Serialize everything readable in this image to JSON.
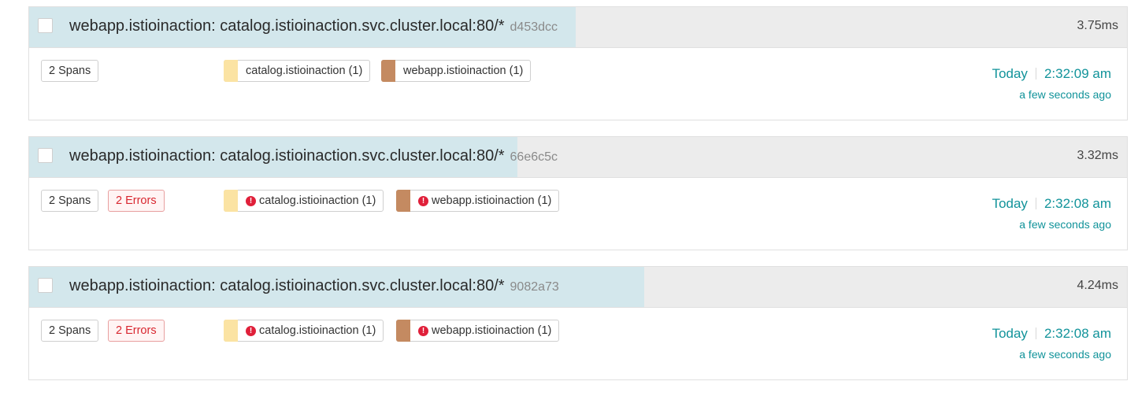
{
  "traces": [
    {
      "title": "webapp.istioinaction: catalog.istioinaction.svc.cluster.local:80/*",
      "trace_id": "d453dcc",
      "duration": "3.75ms",
      "duration_fraction": 0.498,
      "spans_label": "2 Spans",
      "errors_label": "",
      "services": [
        {
          "label": "catalog.istioinaction (1)",
          "color": "#fbe3a3",
          "error": false
        },
        {
          "label": "webapp.istioinaction (1)",
          "color": "#c48a61",
          "error": false
        }
      ],
      "date": "Today",
      "time": "2:32:09 am",
      "relative": "a few seconds ago"
    },
    {
      "title": "webapp.istioinaction: catalog.istioinaction.svc.cluster.local:80/*",
      "trace_id": "66e6c5c",
      "duration": "3.32ms",
      "duration_fraction": 0.445,
      "spans_label": "2 Spans",
      "errors_label": "2 Errors",
      "services": [
        {
          "label": "catalog.istioinaction (1)",
          "color": "#fbe3a3",
          "error": true
        },
        {
          "label": "webapp.istioinaction (1)",
          "color": "#c48a61",
          "error": true
        }
      ],
      "date": "Today",
      "time": "2:32:08 am",
      "relative": "a few seconds ago"
    },
    {
      "title": "webapp.istioinaction: catalog.istioinaction.svc.cluster.local:80/*",
      "trace_id": "9082a73",
      "duration": "4.24ms",
      "duration_fraction": 0.56,
      "spans_label": "2 Spans",
      "errors_label": "2 Errors",
      "services": [
        {
          "label": "catalog.istioinaction (1)",
          "color": "#fbe3a3",
          "error": true
        },
        {
          "label": "webapp.istioinaction (1)",
          "color": "#c48a61",
          "error": true
        }
      ],
      "date": "Today",
      "time": "2:32:08 am",
      "relative": "a few seconds ago"
    }
  ],
  "icons": {
    "error": "error-icon",
    "checkbox": "checkbox"
  }
}
